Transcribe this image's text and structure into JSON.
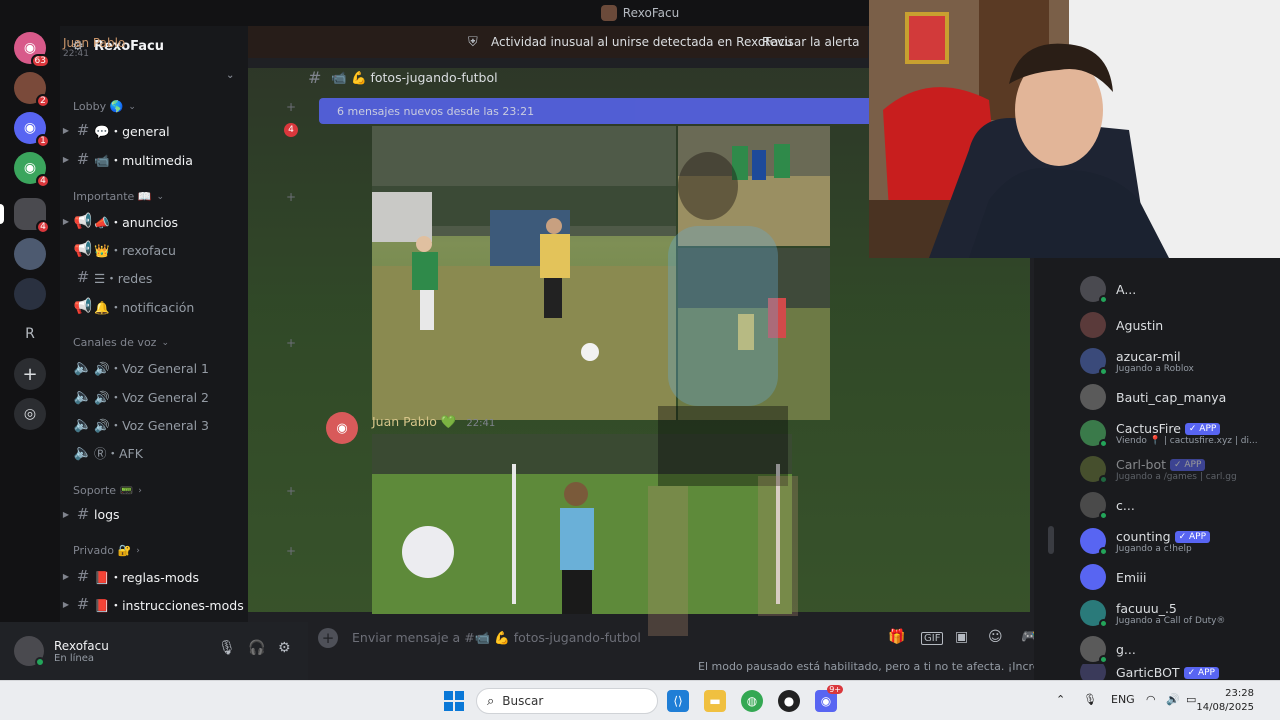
{
  "window": {
    "title": "RexoFacu"
  },
  "alert": {
    "sender": "Juan Pablo",
    "sender_time": "22:41",
    "text": "Actividad inusual al unirse detectada en RexoFacu",
    "action": "Revisar la alerta"
  },
  "rail": {
    "items": [
      {
        "icon": "discord-icon",
        "badge": "63"
      },
      {
        "icon": "server-icon",
        "badge": "2"
      },
      {
        "icon": "discord-icon",
        "badge": "1"
      },
      {
        "icon": "discord-icon",
        "badge": "4"
      },
      {
        "icon": "server-icon",
        "badge": "4"
      },
      {
        "icon": "server-icon",
        "badge": ""
      },
      {
        "icon": "server-icon",
        "badge": ""
      },
      {
        "icon": "letter-icon",
        "label": "R"
      },
      {
        "icon": "plus-icon"
      },
      {
        "icon": "compass-icon"
      }
    ]
  },
  "server": {
    "name": "RexoFacu"
  },
  "categories": {
    "lobby": "Lobby 🌎",
    "importante": "Importante 📖",
    "voz": "Canales de voz",
    "soporte": "Soporte 📟",
    "privado": "Privado 🔐"
  },
  "channels": {
    "general": "💬・general",
    "multimedia": "📹・multimedia",
    "anuncios": "📣・anuncios",
    "rexofacu": "👑・rexofacu",
    "redes": "☰・redes",
    "notificacion": "🔔・notificación",
    "voz1": "🔊・Voz General 1",
    "voz2": "🔊・Voz General 2",
    "voz3": "🔊・Voz General 3",
    "afk": "Ⓡ・AFK",
    "logs": "logs",
    "reglas": "📕・reglas-mods",
    "instrucciones": "📕・instrucciones-mods"
  },
  "unread_badge": "4",
  "chat": {
    "channel": "📹 💪 fotos-jugando-futbol",
    "new_messages": "6 mensajes nuevos desde las 23:21",
    "author": "Juan Pablo 💚",
    "time": "22:41",
    "composer_placeholder": "Enviar mensaje a #📹 💪 fotos-jugando-futbol",
    "slowmode": "El modo pausado está habilitado, pero a ti no te afecta. ¡Increíble!"
  },
  "user": {
    "name": "Rexofacu",
    "status": "En línea"
  },
  "members": [
    {
      "name": "A...",
      "activity": "",
      "app": ""
    },
    {
      "name": "Agustin",
      "activity": "",
      "app": ""
    },
    {
      "name": "azucar-mil",
      "activity": "Jugando a Roblox",
      "app": ""
    },
    {
      "name": "Bauti_cap_manya",
      "activity": "",
      "app": ""
    },
    {
      "name": "CactusFire",
      "activity": "Viendo 📍 | cactusfire.xyz | di...",
      "app": "✓ APP"
    },
    {
      "name": "Carl-bot",
      "activity": "Jugando a /games | carl.gg",
      "app": "✓ APP"
    },
    {
      "name": "c...",
      "activity": "",
      "app": ""
    },
    {
      "name": "counting",
      "activity": "Jugando a c!help",
      "app": "✓ APP"
    },
    {
      "name": "Emiii",
      "activity": "",
      "app": ""
    },
    {
      "name": "facuuu_.5",
      "activity": "Jugando a Call of Duty®",
      "app": ""
    },
    {
      "name": "g...",
      "activity": "",
      "app": ""
    },
    {
      "name": "GarticBOT",
      "activity": "",
      "app": "✓ APP"
    }
  ],
  "taskbar": {
    "search": "Buscar",
    "lang": "ENG",
    "time": "23:28",
    "date": "14/08/2025",
    "discord_badge": "9+"
  }
}
